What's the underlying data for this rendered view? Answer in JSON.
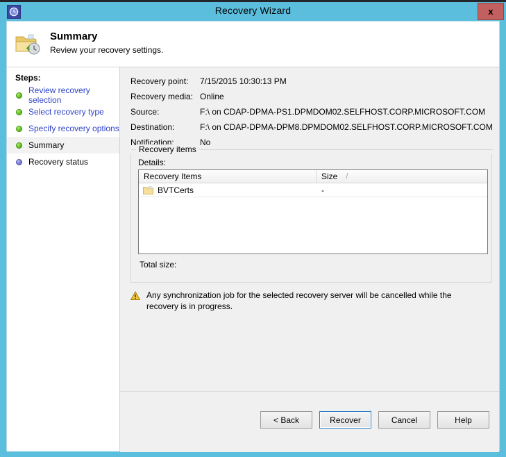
{
  "window": {
    "title": "Recovery Wizard",
    "icon": "recovery-clock-icon",
    "close_label": "x",
    "frame_color": "#5cbedd"
  },
  "header": {
    "icon": "folder-restore-icon",
    "title": "Summary",
    "subtitle": "Review your recovery settings."
  },
  "sidebar": {
    "heading": "Steps:",
    "items": [
      {
        "label": "Review recovery selection",
        "state": "done"
      },
      {
        "label": "Select recovery type",
        "state": "done"
      },
      {
        "label": "Specify recovery options",
        "state": "done"
      },
      {
        "label": "Summary",
        "state": "current"
      },
      {
        "label": "Recovery status",
        "state": "pending"
      }
    ]
  },
  "summary": {
    "fields": [
      {
        "key": "Recovery point:",
        "value": "7/15/2015 10:30:13 PM"
      },
      {
        "key": "Recovery media:",
        "value": "Online"
      },
      {
        "key": "Source:",
        "value": "F:\\ on CDAP-DPMA-PS1.DPMDOM02.SELFHOST.CORP.MICROSOFT.COM"
      },
      {
        "key": "Destination:",
        "value": "F:\\ on CDAP-DPMA-DPM8.DPMDOM02.SELFHOST.CORP.MICROSOFT.COM"
      },
      {
        "key": "Notification:",
        "value": "No"
      }
    ]
  },
  "recovery_items": {
    "group_title": "Recovery items",
    "details_label": "Details:",
    "columns": [
      {
        "label": "Recovery Items",
        "sort_indicator": ""
      },
      {
        "label": "Size",
        "sort_indicator": "/"
      }
    ],
    "rows": [
      {
        "icon": "folder-icon",
        "name": "BVTCerts",
        "size": "-"
      }
    ],
    "total_size_label": "Total size:",
    "total_size_value": ""
  },
  "warning": {
    "icon": "warning-triangle-icon",
    "text": "Any synchronization job for the selected recovery server will be cancelled while the recovery is in progress."
  },
  "footer": {
    "buttons": [
      {
        "label": "< Back",
        "focused": false
      },
      {
        "label": "Recover",
        "focused": true
      },
      {
        "label": "Cancel",
        "focused": false
      },
      {
        "label": "Help",
        "focused": false
      }
    ]
  }
}
